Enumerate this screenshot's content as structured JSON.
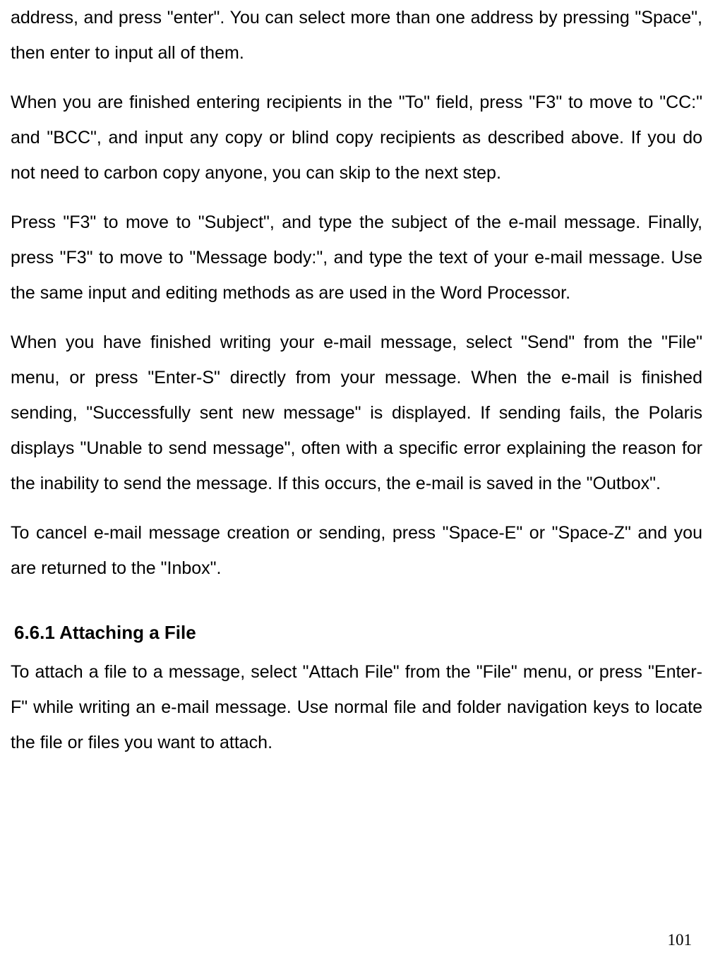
{
  "paragraphs": {
    "p1": "address, and press \"enter\". You can select more than one address by pressing \"Space\", then enter to input all of them.",
    "p2": "When you are finished entering recipients in the \"To\" field, press \"F3\" to move to \"CC:\" and \"BCC\", and input any copy or blind copy recipients as described above. If you do not need to carbon copy anyone, you can skip to the next step.",
    "p3": "Press \"F3\" to move to \"Subject\", and type the subject of the e-mail message. Finally, press \"F3\" to move to \"Message body:\", and type the text of your e-mail message. Use the same input and editing methods as are used in the Word Processor.",
    "p4": "When you have finished writing your e-mail message, select \"Send\" from the \"File\" menu, or press \"Enter-S\" directly from your message. When the e-mail is finished sending, \"Successfully sent new message\" is displayed. If sending fails, the Polaris displays \"Unable to send message\", often with a specific error explaining the reason for the inability to send the message. If this occurs, the e-mail is saved in the \"Outbox\".",
    "p5": "To cancel e-mail message creation or sending, press \"Space-E\" or \"Space-Z\" and you are returned to the \"Inbox\".",
    "p6": "To attach a file to a message, select \"Attach File\" from the \"File\" menu, or press \"Enter-F\" while writing an e-mail message. Use normal file and folder navigation keys to locate the file or files you want to attach."
  },
  "heading": "6.6.1 Attaching a File",
  "pageNumber": "101"
}
